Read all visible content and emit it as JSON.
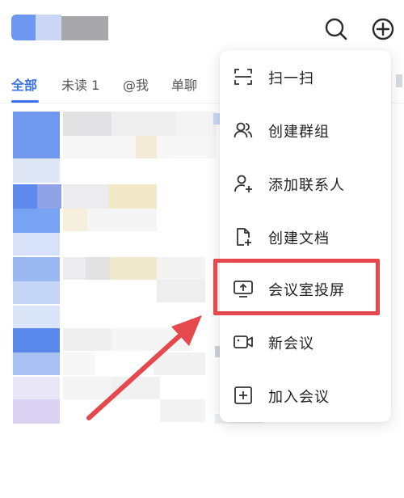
{
  "header": {
    "search_icon": "search-icon",
    "add_icon": "plus-circle-icon"
  },
  "tabs": [
    {
      "label": "全部",
      "active": true
    },
    {
      "label": "未读 1",
      "active": false
    },
    {
      "label": "@我",
      "active": false
    },
    {
      "label": "单聊",
      "active": false
    }
  ],
  "menu": {
    "items": [
      {
        "label": "扫一扫",
        "icon": "scan-icon"
      },
      {
        "label": "创建群组",
        "icon": "group-icon"
      },
      {
        "label": "添加联系人",
        "icon": "add-contact-icon"
      },
      {
        "label": "创建文档",
        "icon": "new-document-icon"
      },
      {
        "label": "会议室投屏",
        "icon": "screen-cast-icon",
        "highlighted": true
      },
      {
        "label": "新会议",
        "icon": "video-camera-icon"
      },
      {
        "label": "加入会议",
        "icon": "join-meeting-icon"
      }
    ]
  },
  "colors": {
    "accent": "#3a72e8",
    "highlight": "#e5484d",
    "arrow": "#e5484d"
  }
}
